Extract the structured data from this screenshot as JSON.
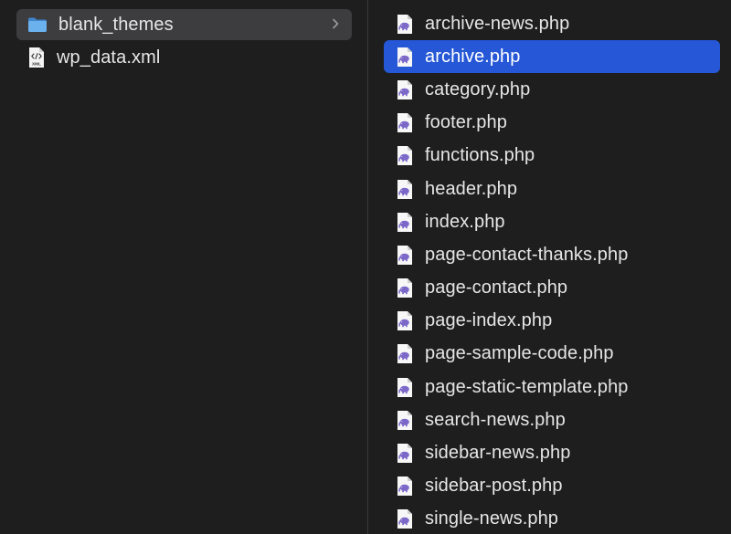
{
  "left_column": {
    "items": [
      {
        "name": "blank_themes",
        "kind": "folder",
        "icon": "folder-icon",
        "state": "open-parent"
      },
      {
        "name": "wp_data.xml",
        "kind": "file",
        "icon": "xml-file-icon",
        "icon_text": "XML"
      }
    ]
  },
  "right_column": {
    "items": [
      {
        "name": "archive-news.php",
        "icon": "php-file-icon"
      },
      {
        "name": "archive.php",
        "icon": "php-file-icon",
        "selected": true
      },
      {
        "name": "category.php",
        "icon": "php-file-icon"
      },
      {
        "name": "footer.php",
        "icon": "php-file-icon"
      },
      {
        "name": "functions.php",
        "icon": "php-file-icon"
      },
      {
        "name": "header.php",
        "icon": "php-file-icon"
      },
      {
        "name": "index.php",
        "icon": "php-file-icon"
      },
      {
        "name": "page-contact-thanks.php",
        "icon": "php-file-icon"
      },
      {
        "name": "page-contact.php",
        "icon": "php-file-icon"
      },
      {
        "name": "page-index.php",
        "icon": "php-file-icon"
      },
      {
        "name": "page-sample-code.php",
        "icon": "php-file-icon"
      },
      {
        "name": "page-static-template.php",
        "icon": "php-file-icon"
      },
      {
        "name": "search-news.php",
        "icon": "php-file-icon"
      },
      {
        "name": "sidebar-news.php",
        "icon": "php-file-icon"
      },
      {
        "name": "sidebar-post.php",
        "icon": "php-file-icon"
      },
      {
        "name": "single-news.php",
        "icon": "php-file-icon"
      }
    ]
  },
  "colors": {
    "background": "#1e1e1e",
    "text": "#e6e6e6",
    "selection": "#2557d6",
    "parent_selection": "#3d3d3f",
    "folder": "#5aa3e8",
    "php_elephant": "#7b68c9"
  }
}
